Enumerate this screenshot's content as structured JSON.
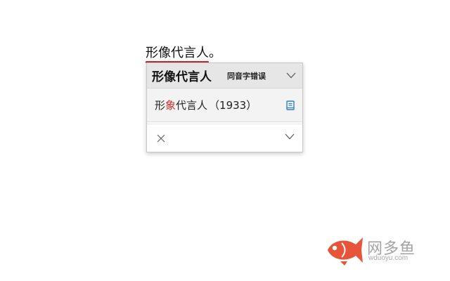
{
  "document": {
    "error_word": "形像代言人",
    "trailing_punct": "。",
    "underline_color": "#c52a2a"
  },
  "card": {
    "header": {
      "title": "形像代言人",
      "category": "同音字错误",
      "chevron_icon": "chevron-down-icon"
    },
    "suggestion": {
      "prefix": "形",
      "highlight": "象",
      "suffix": "代言人",
      "count": "（1933）",
      "highlight_color": "#d22b2b",
      "icon": "book-icon",
      "icon_color": "#2f7fd0"
    },
    "footer": {
      "close_icon": "close-icon",
      "more_icon": "chevron-down-icon"
    }
  },
  "watermark": {
    "name": "网多鱼",
    "url": "wduoyu.com",
    "logo_icon": "fish-logo-icon",
    "logo_color": "#e8543a"
  }
}
